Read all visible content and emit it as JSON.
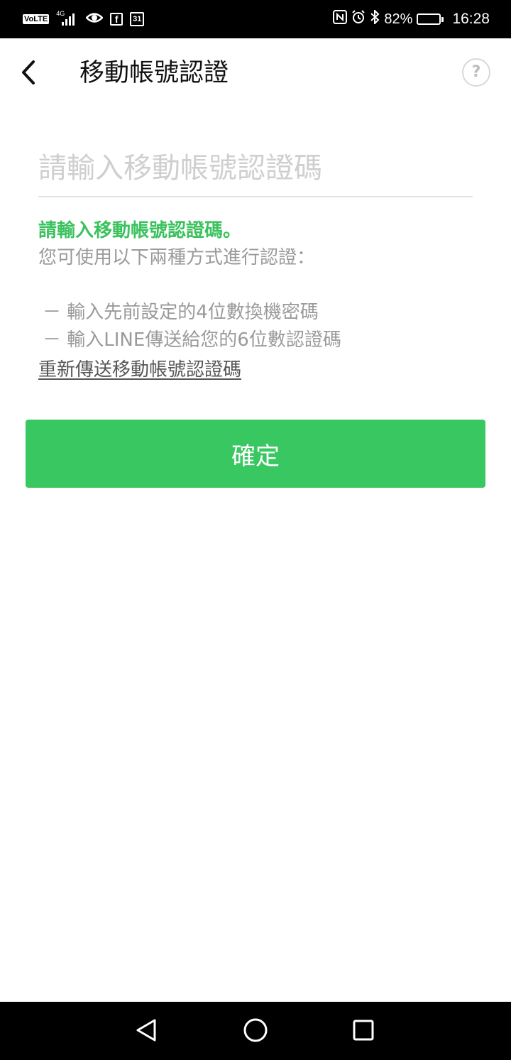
{
  "status_bar": {
    "volte": "VoLTE",
    "network": "4G",
    "battery_percent": "82%",
    "battery_level": 0.82,
    "time": "16:28",
    "calendar_day": "31",
    "facebook_glyph": "f",
    "icons": [
      "volte-icon",
      "signal-icon",
      "eye-icon",
      "facebook-icon",
      "calendar-icon",
      "nfc-icon",
      "alarm-icon",
      "bluetooth-icon",
      "battery-icon"
    ]
  },
  "header": {
    "title": "移動帳號認證",
    "help_label": "?"
  },
  "code_input": {
    "placeholder": "請輸入移動帳號認證碼",
    "value": ""
  },
  "instructions": {
    "primary": "請輸入移動帳號認證碼。",
    "secondary": "您可使用以下兩種方式進行認證：",
    "options": [
      "－ 輸入先前設定的4位數換機密碼",
      "－ 輸入LINE傳送給您的6位數認證碼"
    ]
  },
  "resend_link": "重新傳送移動帳號認證碼",
  "confirm_button": "確定",
  "colors": {
    "accent_green": "#38c760",
    "text_green": "#3bc25e"
  }
}
